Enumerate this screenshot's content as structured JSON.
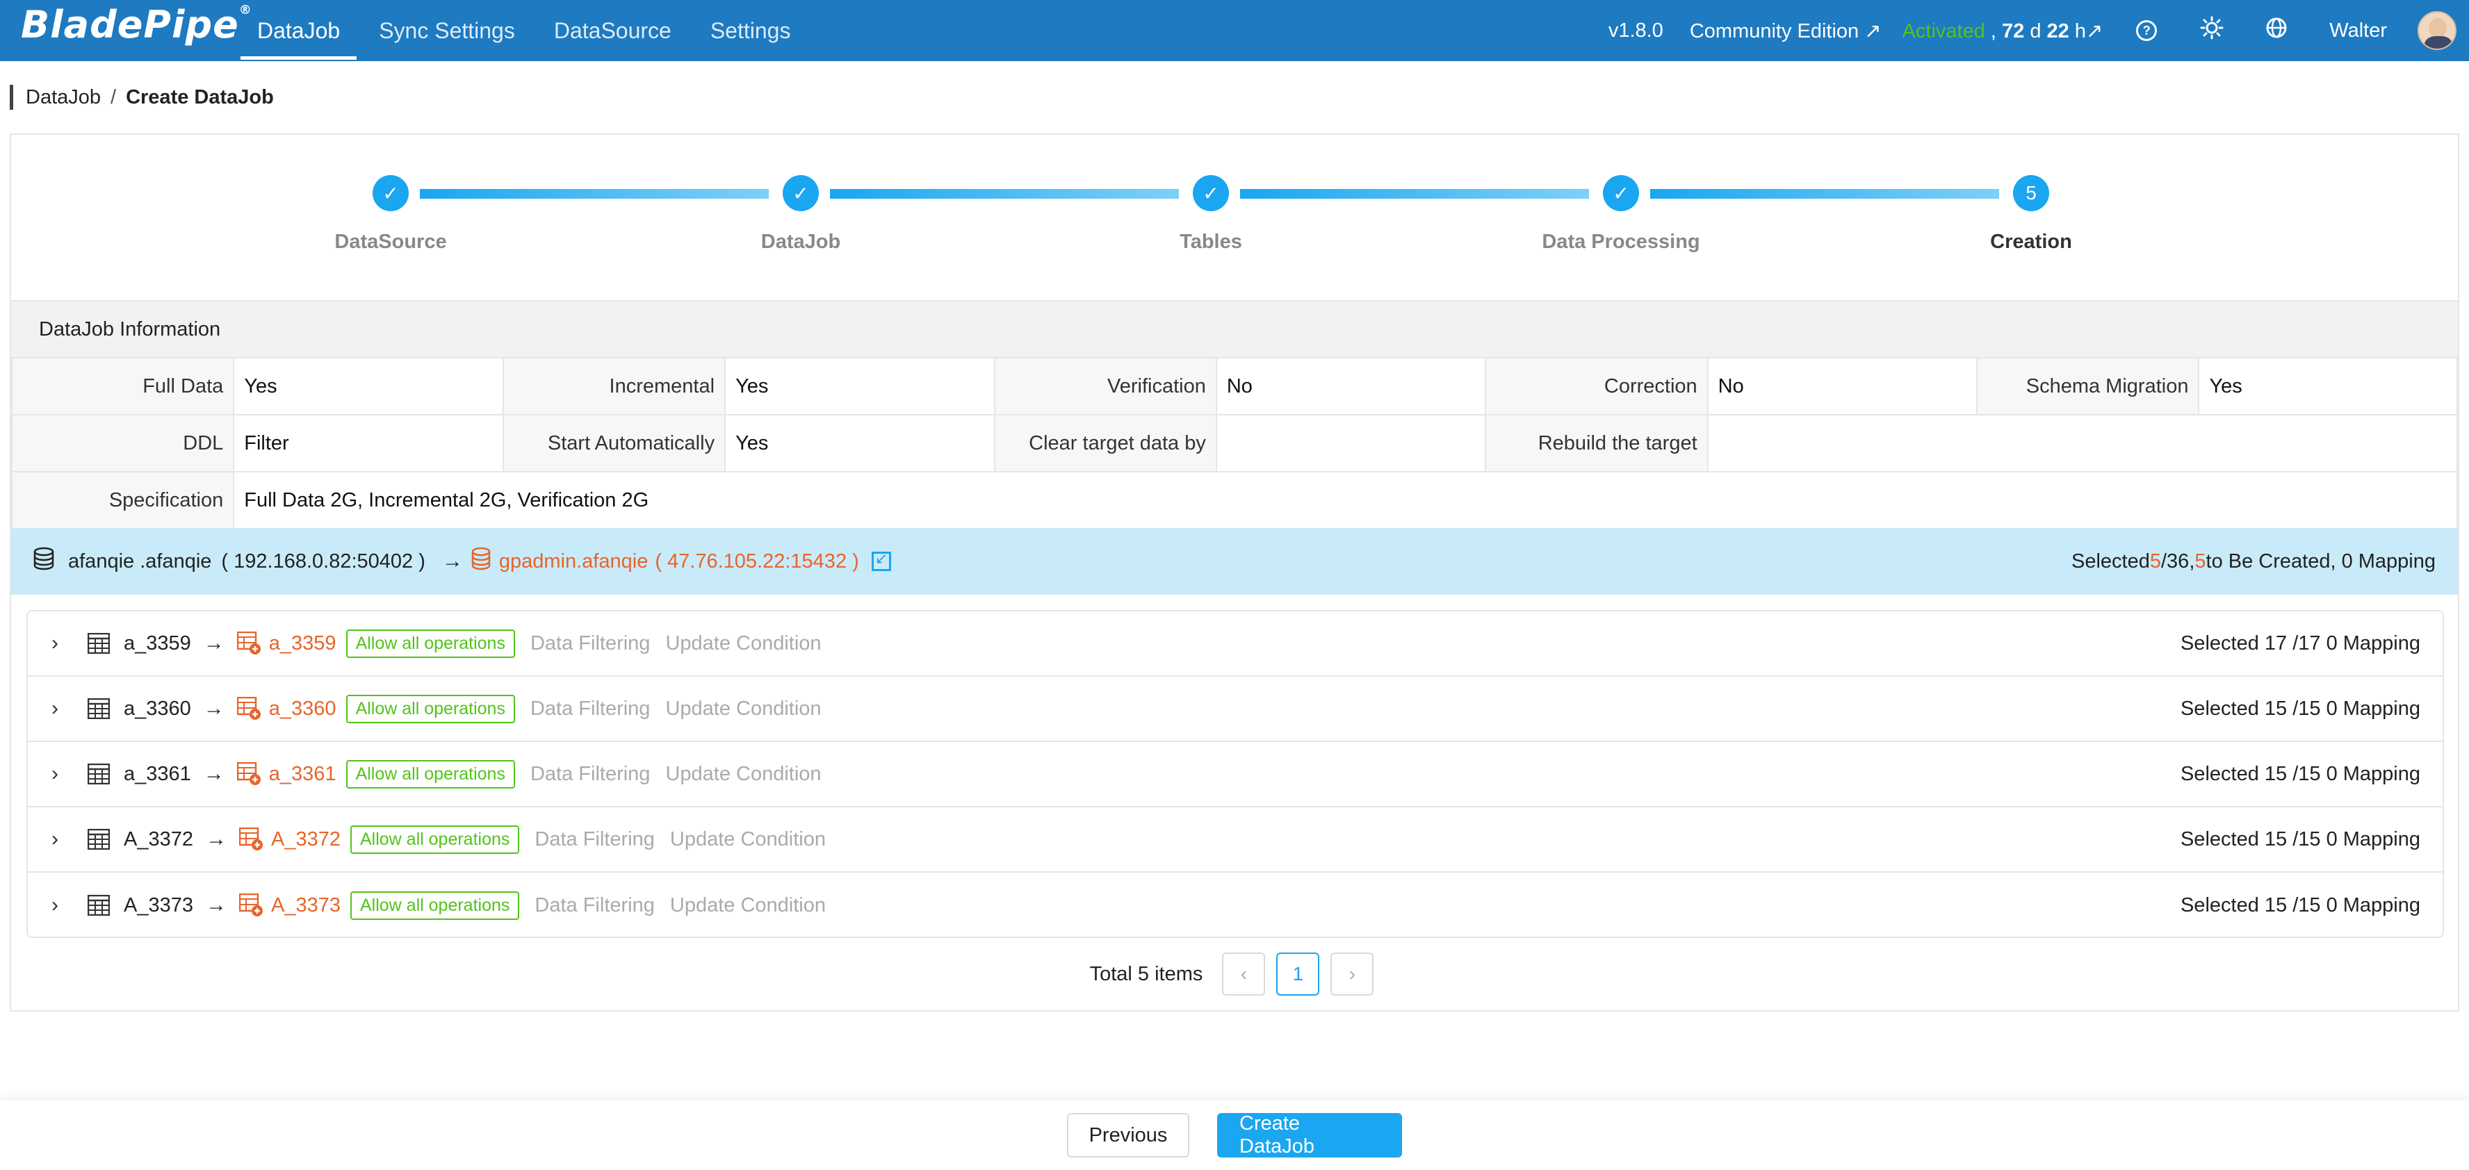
{
  "header": {
    "logo": "BladePipe",
    "nav": [
      "DataJob",
      "Sync Settings",
      "DataSource",
      "Settings"
    ],
    "version": "v1.8.0",
    "edition": "Community Edition ↗",
    "activated": "Activated",
    "days_prefix": " , ",
    "days_num": "72",
    "days_d": " d ",
    "hours_num": "22",
    "hours_h": " h↗",
    "user": "Walter"
  },
  "breadcrumb": {
    "root": "DataJob",
    "sep": "/",
    "current": "Create DataJob"
  },
  "steps": [
    {
      "label": "DataSource",
      "done": true
    },
    {
      "label": "DataJob",
      "done": true
    },
    {
      "label": "Tables",
      "done": true
    },
    {
      "label": "Data Processing",
      "done": true
    },
    {
      "label": "Creation",
      "number": "5",
      "done": false
    }
  ],
  "info": {
    "title": "DataJob Information",
    "rows": [
      [
        [
          "Full Data",
          "Yes"
        ],
        [
          "Incremental",
          "Yes"
        ],
        [
          "Verification",
          "No"
        ],
        [
          "Correction",
          "No"
        ],
        [
          "Schema Migration",
          "Yes"
        ]
      ],
      [
        [
          "DDL",
          "Filter"
        ],
        [
          "Start Automatically",
          "Yes"
        ],
        [
          "Clear target data by",
          ""
        ],
        [
          "Rebuild the target",
          ""
        ]
      ],
      [
        [
          "Specification",
          "Full Data 2G, Incremental 2G, Verification 2G"
        ]
      ]
    ]
  },
  "source_bar": {
    "src_name": "afanqie .afanqie",
    "src_host": "( 192.168.0.82:50402 )",
    "arrow": "→",
    "tgt_name": "gpadmin.afanqie",
    "tgt_host": "( 47.76.105.22:15432 )",
    "summary_prefix": "Selected ",
    "summary_sel": "5",
    "summary_mid": " /36, ",
    "summary_create": "5",
    "summary_suffix": " to Be Created, 0 Mapping"
  },
  "tables": [
    {
      "src": "a_3359",
      "tgt": "a_3359",
      "tag": "Allow all operations",
      "filter": "Data Filtering",
      "cond": "Update Condition",
      "selected": "Selected 17 /17 0 Mapping"
    },
    {
      "src": "a_3360",
      "tgt": "a_3360",
      "tag": "Allow all operations",
      "filter": "Data Filtering",
      "cond": "Update Condition",
      "selected": "Selected 15 /15 0 Mapping"
    },
    {
      "src": "a_3361",
      "tgt": "a_3361",
      "tag": "Allow all operations",
      "filter": "Data Filtering",
      "cond": "Update Condition",
      "selected": "Selected 15 /15 0 Mapping"
    },
    {
      "src": "A_3372",
      "tgt": "A_3372",
      "tag": "Allow all operations",
      "filter": "Data Filtering",
      "cond": "Update Condition",
      "selected": "Selected 15 /15 0 Mapping"
    },
    {
      "src": "A_3373",
      "tgt": "A_3373",
      "tag": "Allow all operations",
      "filter": "Data Filtering",
      "cond": "Update Condition",
      "selected": "Selected 15 /15 0 Mapping"
    }
  ],
  "pager": {
    "total": "Total 5 items",
    "prev": "‹",
    "page": "1",
    "next": "›"
  },
  "footer": {
    "previous": "Previous",
    "create": "Create DataJob"
  },
  "colors": {
    "brand": "#1e7ac1",
    "accent": "#1aa6f0",
    "target": "#e8642a",
    "tag": "#52c41a"
  }
}
